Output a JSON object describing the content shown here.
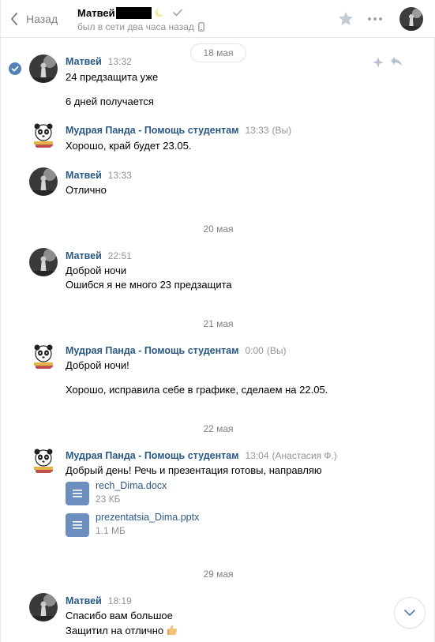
{
  "header": {
    "back_label": "Назад",
    "contact_name": "Матвей",
    "status": "был в сети два часа назад"
  },
  "colors": {
    "link": "#2a5885",
    "accent": "#5181b8",
    "muted": "#939393",
    "doc_icon": "#6d8fc0"
  },
  "icons": [
    "chevron-left-icon",
    "mobile-phone-icon",
    "star-icon",
    "more-icon",
    "chevron-down-icon",
    "reply-icon",
    "sparkle-icon",
    "document-icon"
  ],
  "dates": {
    "d1": "18 мая",
    "d2": "20 мая",
    "d3": "21 мая",
    "d4": "22 мая",
    "d5": "29 мая"
  },
  "messages": [
    {
      "sender": "Матвей",
      "time": "13:32",
      "note": "",
      "lines": [
        "24 предзащита уже",
        "6 дней получается"
      ]
    },
    {
      "sender": "Мудрая Панда - Помощь студентам",
      "time": "13:33",
      "note": "(Вы)",
      "lines": [
        "Хорошо, край будет 23.05."
      ]
    },
    {
      "sender": "Матвей",
      "time": "13:33",
      "note": "",
      "lines": [
        "Отлично"
      ]
    },
    {
      "sender": "Матвей",
      "time": "22:51",
      "note": "",
      "lines": [
        "Доброй ночи",
        "Ошибся я не много 23 предзащита"
      ]
    },
    {
      "sender": "Мудрая Панда - Помощь студентам",
      "time": "0:00",
      "note": "(Вы)",
      "lines": [
        "Доброй ночи!",
        "Хорошо, исправила себе в графике, сделаем на 22.05."
      ]
    },
    {
      "sender": "Мудрая Панда - Помощь студентам",
      "time": "13:04",
      "note": "(Анастасия Ф.)",
      "lines": [
        "Добрый день! Речь и презентация готовы, направляю"
      ],
      "attachments": [
        {
          "name": "rech_Dima.docx",
          "size": "23 КБ"
        },
        {
          "name": "prezentatsia_Dima.pptx",
          "size": "1.1 МБ"
        }
      ]
    },
    {
      "sender": "Матвей",
      "time": "18:19",
      "note": "",
      "lines": [
        "Спасибо вам большое",
        "Защитил на отлично"
      ]
    }
  ]
}
